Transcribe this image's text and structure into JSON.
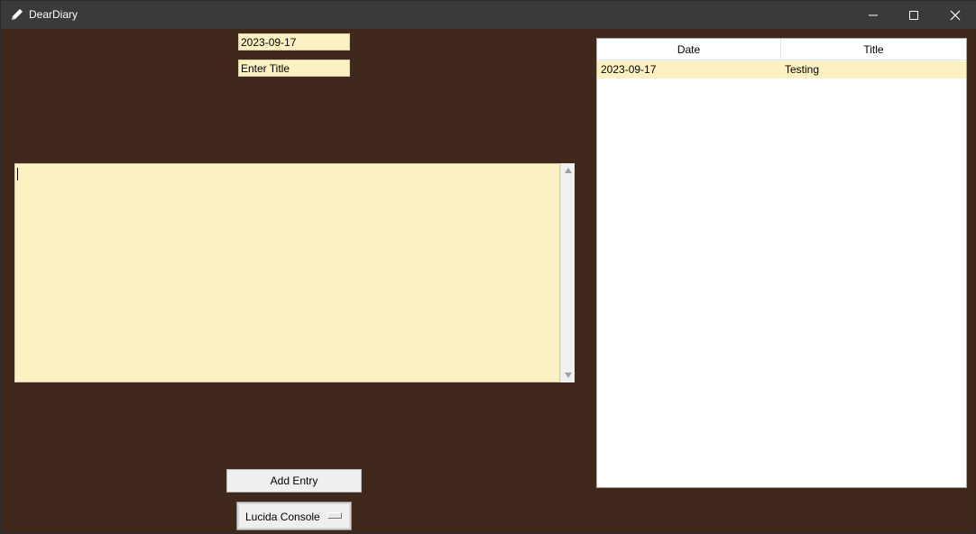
{
  "window": {
    "title": "DearDiary",
    "icon": "pencil-icon",
    "controls": [
      "minimize-icon",
      "maximize-icon",
      "close-icon"
    ]
  },
  "form": {
    "date_value": "2023-09-17",
    "title_value": "Enter Title",
    "body_text": "",
    "add_button_label": "Add Entry",
    "font_selected": "Lucida Console"
  },
  "table": {
    "columns": [
      "Date",
      "Title"
    ],
    "rows": [
      {
        "date": "2023-09-17",
        "title": "Testing"
      }
    ]
  },
  "colors": {
    "background": "#41281d",
    "field": "#fcf1c2",
    "titlebar": "#3a3a3a"
  }
}
